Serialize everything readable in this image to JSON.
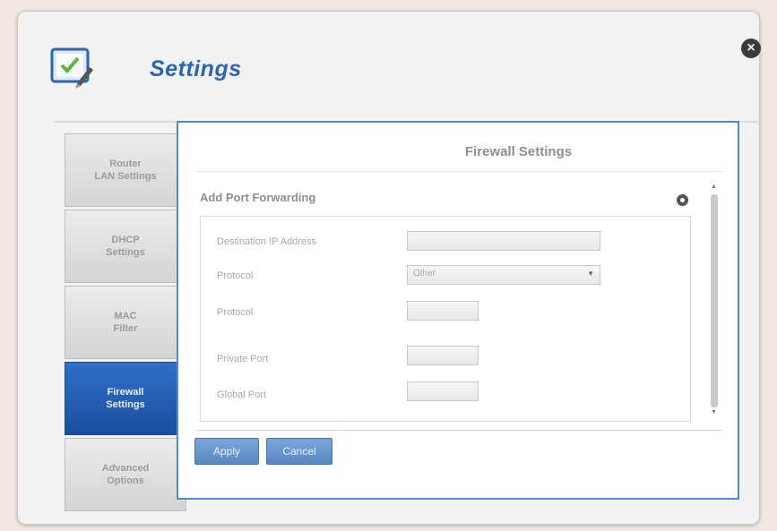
{
  "window": {
    "title": "Settings"
  },
  "sidebar": {
    "items": [
      {
        "line1": "Router",
        "line2": "LAN Settings",
        "active": false
      },
      {
        "line1": "DHCP",
        "line2": "Settings",
        "active": false
      },
      {
        "line1": "MAC",
        "line2": "Filter",
        "active": false
      },
      {
        "line1": "Firewall",
        "line2": "Settings",
        "active": true
      },
      {
        "line1": "Advanced",
        "line2": "Options",
        "active": false
      }
    ]
  },
  "main": {
    "title": "Firewall Settings",
    "section_title": "Add Port Forwarding",
    "form": {
      "destination_ip_label": "Destination IP Address",
      "destination_ip_value": "",
      "protocol_select_label": "Protocol",
      "protocol_select_value": "Other",
      "protocol_number_label": "Protocol",
      "protocol_number_value": "",
      "private_port_label": "Private Port",
      "private_port_value": "",
      "global_port_label": "Global Port",
      "global_port_value": ""
    },
    "buttons": {
      "apply": "Apply",
      "cancel": "Cancel"
    }
  },
  "colors": {
    "accent": "#2c64b5",
    "active_tab": "#1c4f9e",
    "panel_border": "#4f8ad6",
    "button": "#6a96d0"
  },
  "icons": {
    "header": "settings-checklist-icon",
    "close": "close-icon",
    "section_action": "gear-icon",
    "select": "chevron-down-icon"
  }
}
